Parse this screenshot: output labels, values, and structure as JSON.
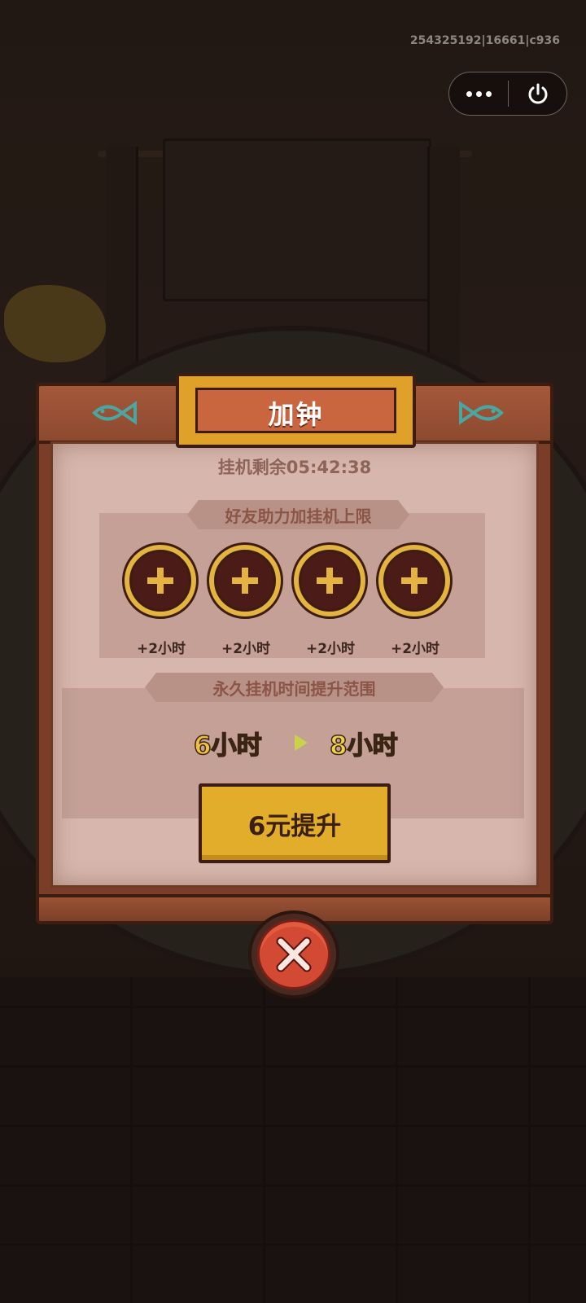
{
  "system": {
    "debug_id": "254325192|16661|c936",
    "capsule": {
      "more_icon": "more-dots-icon",
      "exit_icon": "power-icon"
    }
  },
  "dialog": {
    "title": "加钟",
    "timer_text": "挂机剩余05:42:38",
    "friend_section": {
      "heading": "好友助力加挂机上限",
      "slots": [
        {
          "label": "+2小时",
          "icon": "plus-icon"
        },
        {
          "label": "+2小时",
          "icon": "plus-icon"
        },
        {
          "label": "+2小时",
          "icon": "plus-icon"
        },
        {
          "label": "+2小时",
          "icon": "plus-icon"
        }
      ]
    },
    "upgrade_section": {
      "heading": "永久挂机时间提升范围",
      "from": "6小时",
      "to": "8小时",
      "button_label": "6元提升"
    },
    "close_icon": "close-x-icon"
  },
  "colors": {
    "wood": "#8c4a2f",
    "paper": "#d7b7ad",
    "gold": "#e3ad2c",
    "close_red": "#d24a33",
    "fish_teal": "#4aa6a0"
  }
}
